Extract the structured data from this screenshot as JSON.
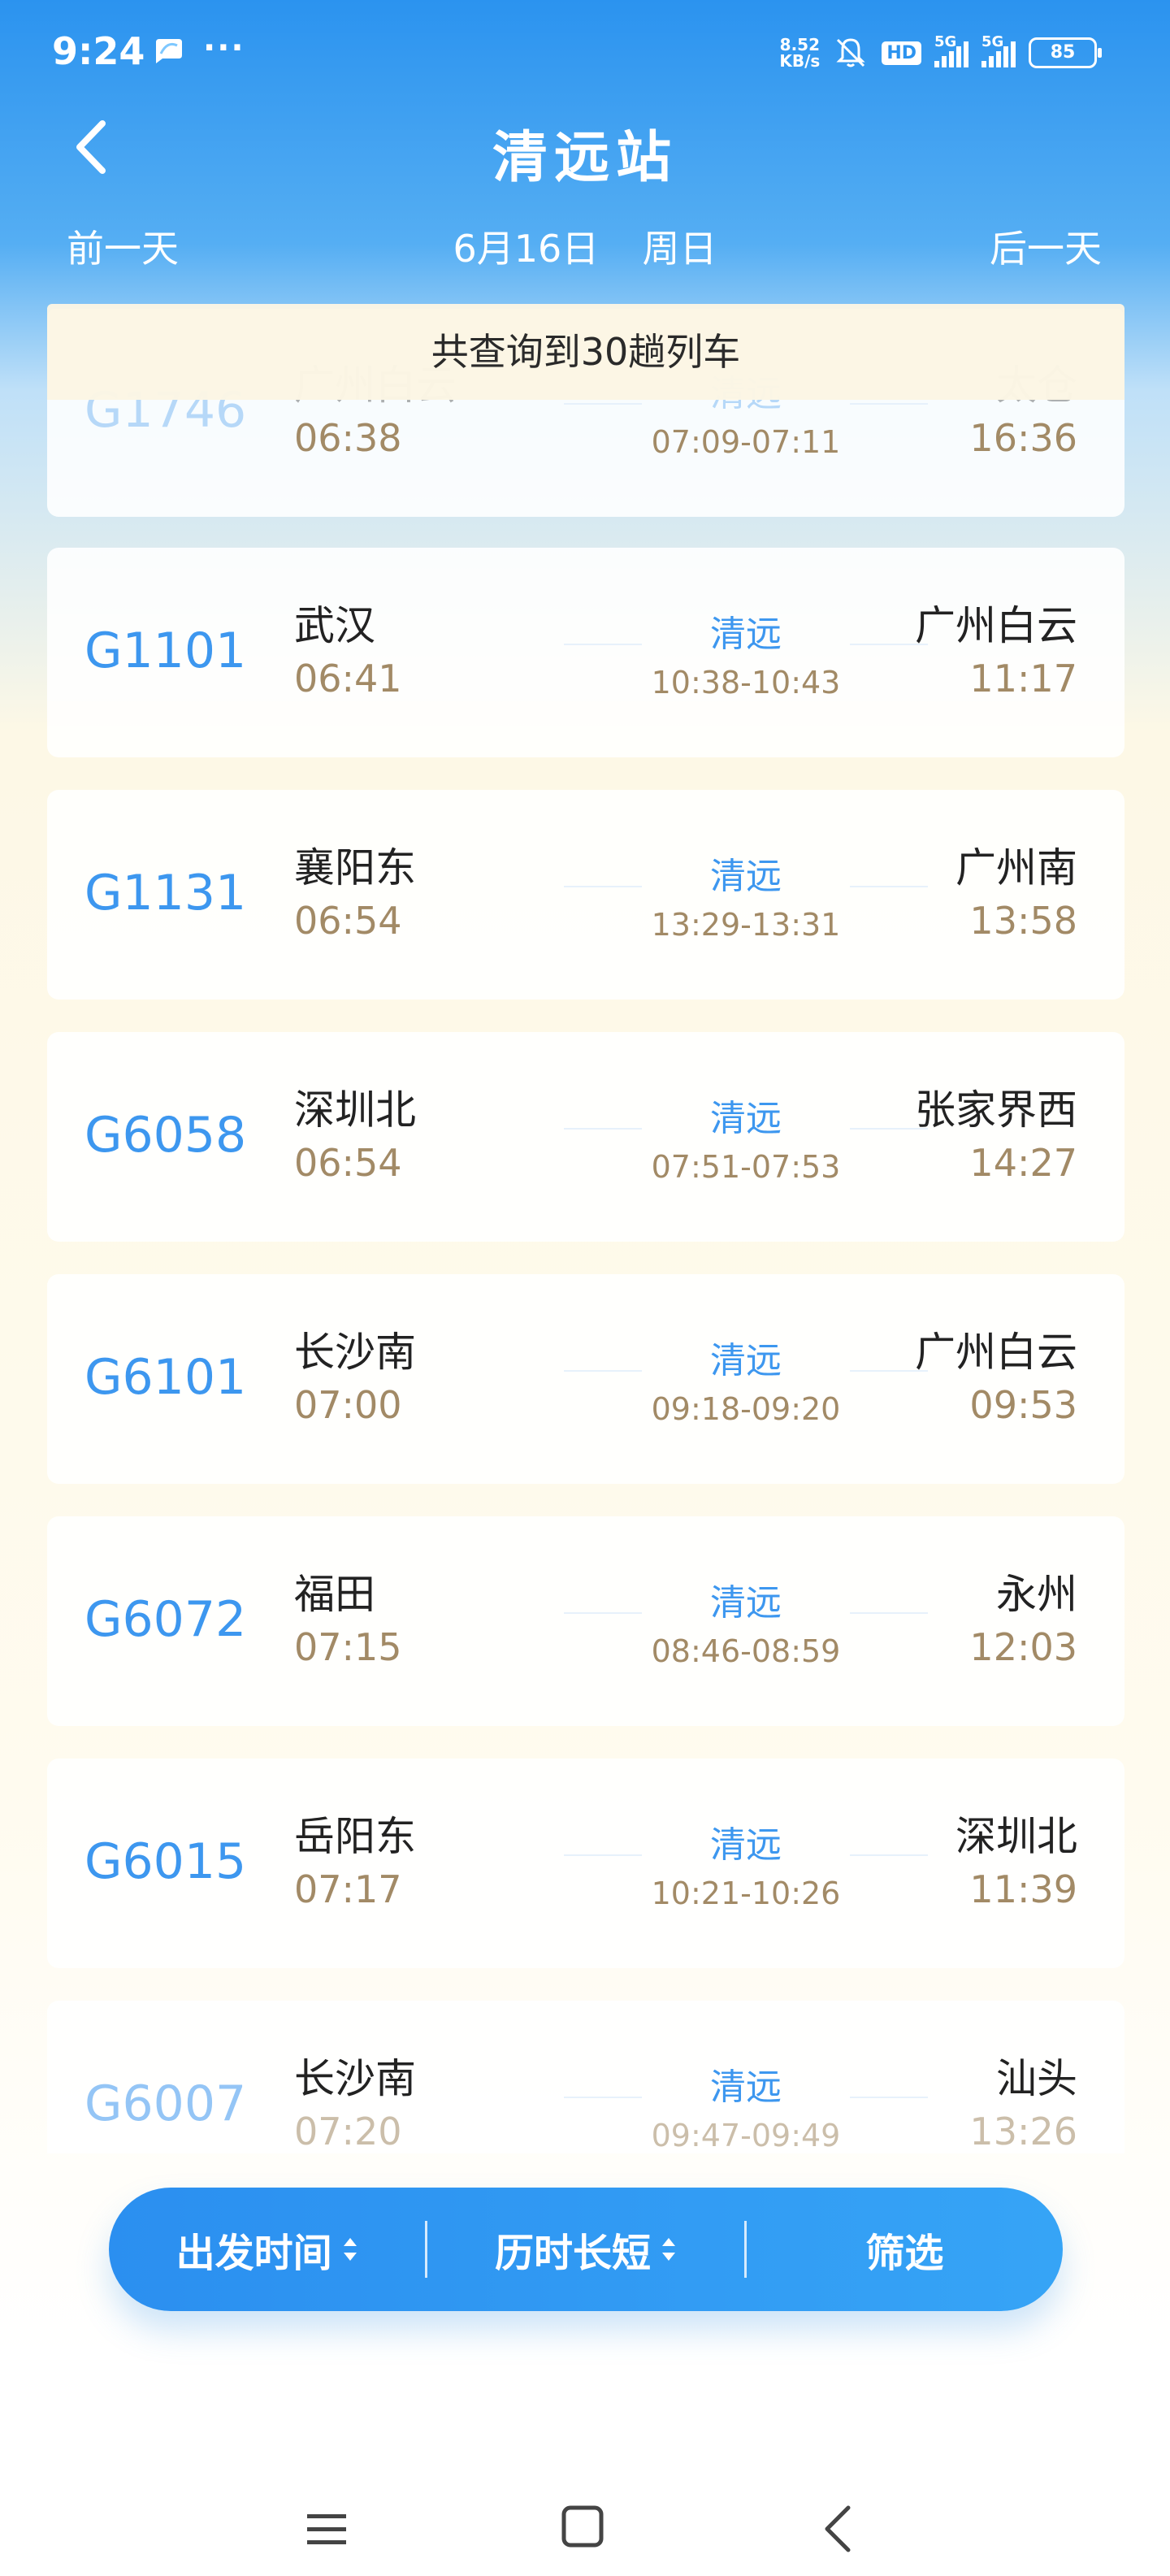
{
  "status_bar": {
    "time": "9:24",
    "more": "···",
    "net_speed_value": "8.52",
    "net_speed_unit": "KB/s",
    "hd_badge": "HD",
    "sim1_label": "5G",
    "sim2_label": "5G",
    "battery": "85",
    "icons": [
      "chat-app-icon",
      "mute-bell-icon",
      "hd-icon",
      "signal-icon",
      "signal-icon",
      "battery-icon"
    ]
  },
  "header": {
    "title": "清远站",
    "prev_day": "前一天",
    "date": "6月16日",
    "weekday": "周日",
    "next_day": "后一天"
  },
  "summary": "共查询到30趟列车",
  "trains": [
    {
      "no": "G1746",
      "from": "广州白云",
      "dep": "06:38",
      "via": "清远",
      "via_time": "07:09-07:11",
      "to": "太仓",
      "arr": "16:36"
    },
    {
      "no": "G1101",
      "from": "武汉",
      "dep": "06:41",
      "via": "清远",
      "via_time": "10:38-10:43",
      "to": "广州白云",
      "arr": "11:17"
    },
    {
      "no": "G1131",
      "from": "襄阳东",
      "dep": "06:54",
      "via": "清远",
      "via_time": "13:29-13:31",
      "to": "广州南",
      "arr": "13:58"
    },
    {
      "no": "G6058",
      "from": "深圳北",
      "dep": "06:54",
      "via": "清远",
      "via_time": "07:51-07:53",
      "to": "张家界西",
      "arr": "14:27"
    },
    {
      "no": "G6101",
      "from": "长沙南",
      "dep": "07:00",
      "via": "清远",
      "via_time": "09:18-09:20",
      "to": "广州白云",
      "arr": "09:53"
    },
    {
      "no": "G6072",
      "from": "福田",
      "dep": "07:15",
      "via": "清远",
      "via_time": "08:46-08:59",
      "to": "永州",
      "arr": "12:03"
    },
    {
      "no": "G6015",
      "from": "岳阳东",
      "dep": "07:17",
      "via": "清远",
      "via_time": "10:21-10:26",
      "to": "深圳北",
      "arr": "11:39"
    },
    {
      "no": "G6007",
      "from": "长沙南",
      "dep": "07:20",
      "via": "清远",
      "via_time": "09:47-09:49",
      "to": "汕头",
      "arr": "13:26"
    }
  ],
  "bottom_bar": {
    "sort_departure": "出发时间",
    "sort_duration": "历时长短",
    "filter": "筛选"
  },
  "colors": {
    "primary": "#3d97ef",
    "time_text": "#a28a66",
    "header_bg": "#2b93ef"
  }
}
